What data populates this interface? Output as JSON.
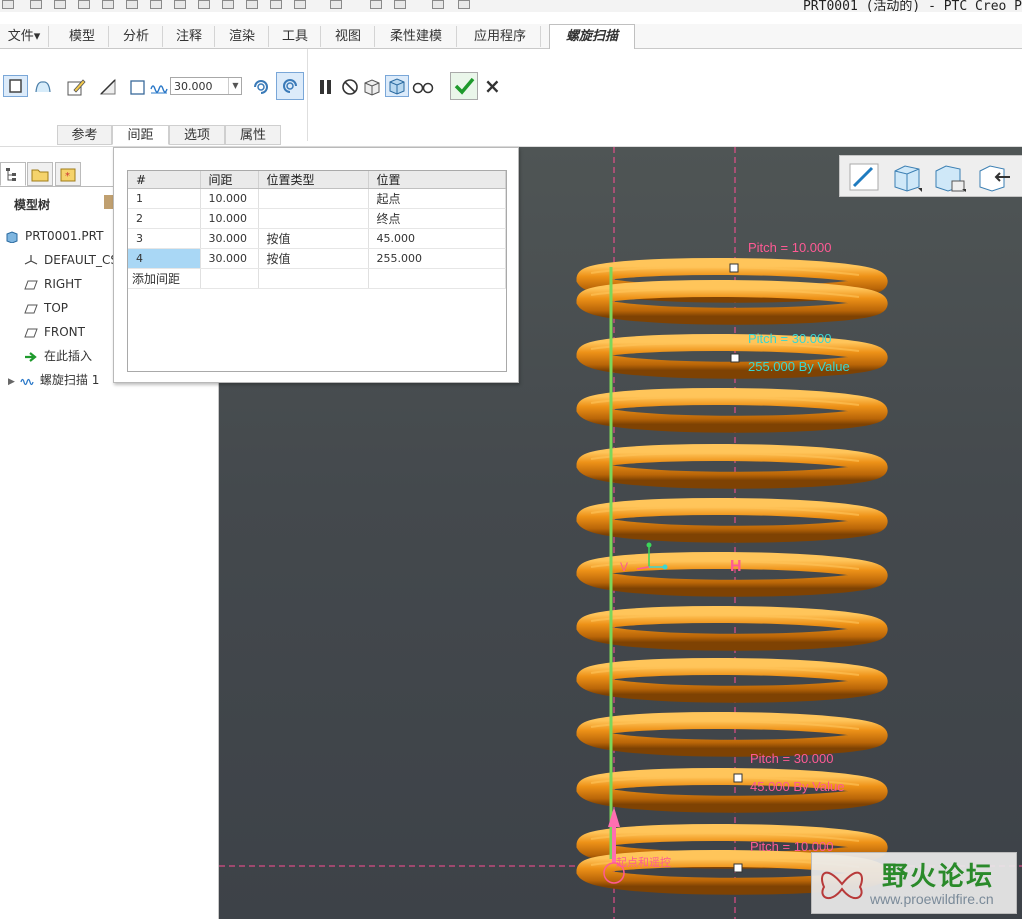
{
  "window": {
    "title": "PRT0001 (活动的) - PTC Creo P"
  },
  "tabs": [
    {
      "label": "文件"
    },
    {
      "label": "模型"
    },
    {
      "label": "分析"
    },
    {
      "label": "注释"
    },
    {
      "label": "渲染"
    },
    {
      "label": "工具"
    },
    {
      "label": "视图"
    },
    {
      "label": "柔性建模"
    },
    {
      "label": "应用程序"
    },
    {
      "label": "螺旋扫描"
    }
  ],
  "file_menu_arrow": "▾",
  "ribbon": {
    "pitch_value": "30.000",
    "confirm_icon": "check-icon",
    "cancel_label": "×",
    "subtabs": [
      {
        "label": "参考"
      },
      {
        "label": "间距"
      },
      {
        "label": "选项"
      },
      {
        "label": "属性"
      }
    ]
  },
  "model_tree": {
    "title": "模型树",
    "items": [
      {
        "label": "PRT0001.PRT"
      },
      {
        "label": "DEFAULT_CS"
      },
      {
        "label": "RIGHT"
      },
      {
        "label": "TOP"
      },
      {
        "label": "FRONT"
      },
      {
        "label": "在此插入"
      },
      {
        "label": "螺旋扫描 1"
      }
    ]
  },
  "pitch_table": {
    "headers": [
      "#",
      "间距",
      "位置类型",
      "位置"
    ],
    "rows": [
      {
        "index": "1",
        "pitch": "10.000",
        "type": "",
        "location": "起点"
      },
      {
        "index": "2",
        "pitch": "10.000",
        "type": "",
        "location": "终点"
      },
      {
        "index": "3",
        "pitch": "30.000",
        "type": "按值",
        "location": "45.000"
      },
      {
        "index": "4",
        "pitch": "30.000",
        "type": "按值",
        "location": "255.000"
      }
    ],
    "add_row_label": "添加间距"
  },
  "viewport": {
    "labels": {
      "top_pitch": "Pitch = 10.000",
      "mid_pitch": "Pitch = 30.000",
      "mid_value": "255.000 By Value",
      "low_pitch": "Pitch = 30.000",
      "low_value": "45.000 By Value",
      "bottom_pitch": "Pitch = 10.000",
      "start_label": "起点和遥控",
      "axis_v": "V",
      "axis_h": "H"
    },
    "colors": {
      "spring": "#e88a10",
      "spring_shadow": "#9a5205",
      "spring_highlight": "#ffc55a",
      "axis_line": "#7cd65a",
      "dashed": "#ff4d94"
    }
  },
  "watermark": {
    "title": "野火论坛",
    "url": "www.proewildfire.cn"
  }
}
